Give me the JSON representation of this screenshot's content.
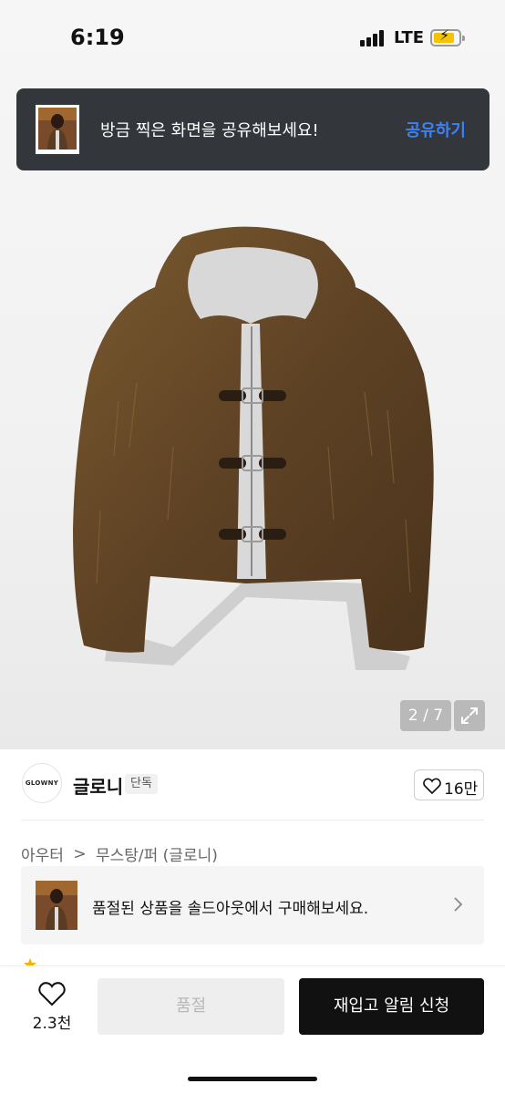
{
  "status_bar": {
    "time": "6:19",
    "network": "LTE",
    "battery_color": "#f5c400"
  },
  "toast": {
    "message": "방금 찍은 화면을 공유해보세요!",
    "action": "공유하기",
    "action_color": "#3b82f6"
  },
  "gallery": {
    "pager": "2 / 7",
    "expand_icon": "expand-icon"
  },
  "brand": {
    "logo_text": "GLOWNY",
    "name": "글로니",
    "badge": "단독",
    "like_count": "16만"
  },
  "breadcrumb": {
    "level1": "아우터",
    "separator": ">",
    "level2": "무스탕/퍼 (글로니)"
  },
  "soldout_banner": {
    "text": "품절된 상품을 솔드아웃에서 구매해보세요."
  },
  "bottom_bar": {
    "wish_count": "2.3천",
    "soldout_label": "품절",
    "restock_label": "재입고 알림 신청"
  }
}
